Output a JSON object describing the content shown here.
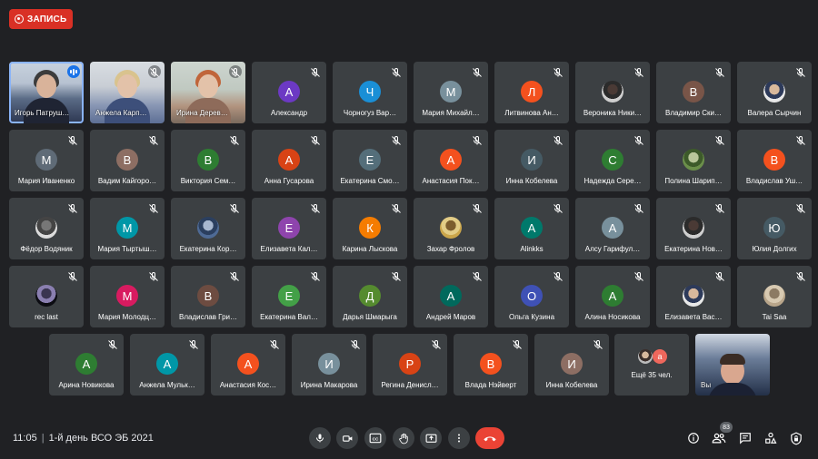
{
  "recording": {
    "label": "ЗАПИСЬ"
  },
  "meeting": {
    "time": "11:05",
    "title": "1-й день ВСО ЭБ 2021"
  },
  "participants_count": "83",
  "more_tile": {
    "label": "Ещё 35 чел.",
    "avatar_letter": "а",
    "avatar_color": "#ee675c"
  },
  "rows": [
    [
      {
        "name": "Игорь Патруш…",
        "video": "v1",
        "speaking": true
      },
      {
        "name": "Анжела Карп…",
        "video": "v2"
      },
      {
        "name": "Ирина Дерев…",
        "video": "v3"
      },
      {
        "name": "Александр",
        "letter": "А",
        "color": "#6c39c4"
      },
      {
        "name": "Чорногуз Вар…",
        "letter": "Ч",
        "color": "#1a8fd6"
      },
      {
        "name": "Мария Михайл…",
        "letter": "М",
        "color": "#78909c"
      },
      {
        "name": "Литвинова Ан…",
        "letter": "Л",
        "color": "#f4511e"
      },
      {
        "name": "Вероника Ники…",
        "photo": "p-dark"
      },
      {
        "name": "Владимир Ски…",
        "letter": "В",
        "color": "#795548"
      },
      {
        "name": "Валера Сырчин",
        "photo": "p-light"
      }
    ],
    [
      {
        "name": "Мария Иваненко",
        "letter": "М",
        "color": "#5f6b77"
      },
      {
        "name": "Вадим Кайгоро…",
        "letter": "В",
        "color": "#8d6e63"
      },
      {
        "name": "Виктория Сем…",
        "letter": "В",
        "color": "#2e7d32"
      },
      {
        "name": "Анна Гусарова",
        "letter": "А",
        "color": "#d84315"
      },
      {
        "name": "Екатерина Смо…",
        "letter": "Е",
        "color": "#546e7a"
      },
      {
        "name": "Анастасия Пок…",
        "letter": "А",
        "color": "#f4511e"
      },
      {
        "name": "Инна Кобелева",
        "letter": "И",
        "color": "#455a64"
      },
      {
        "name": "Надежда Сере…",
        "letter": "С",
        "color": "#2e7d32"
      },
      {
        "name": "Полина Шарип…",
        "photo": "p-green"
      },
      {
        "name": "Владислав Уш…",
        "letter": "В",
        "color": "#f4511e"
      }
    ],
    [
      {
        "name": "Фёдор Водяник",
        "photo": "p-grey"
      },
      {
        "name": "Мария Тыртыш…",
        "letter": "М",
        "color": "#0097a7"
      },
      {
        "name": "Екатерина Кор…",
        "photo": "p-blue"
      },
      {
        "name": "Елизавета Кал…",
        "letter": "Е",
        "color": "#8e44ad"
      },
      {
        "name": "Карина Лыскова",
        "letter": "К",
        "color": "#f57c00"
      },
      {
        "name": "Захар Фролов",
        "photo": "p-yellow"
      },
      {
        "name": "Alinkks",
        "letter": "A",
        "color": "#00796b"
      },
      {
        "name": "Алсу Гарифул…",
        "letter": "А",
        "color": "#78909c"
      },
      {
        "name": "Екатерина Нов…",
        "photo": "p-dark"
      },
      {
        "name": "Юлия Долгих",
        "letter": "Ю",
        "color": "#455a64"
      }
    ],
    [
      {
        "name": "rec last",
        "photo": "p-black"
      },
      {
        "name": "Мария Молодц…",
        "letter": "М",
        "color": "#d81b60"
      },
      {
        "name": "Владислав Гри…",
        "letter": "В",
        "color": "#6d4c41"
      },
      {
        "name": "Екатерина Вал…",
        "letter": "Е",
        "color": "#43a047"
      },
      {
        "name": "Дарья Шмарыга",
        "letter": "Д",
        "color": "#558b2f"
      },
      {
        "name": "Андрей Маров",
        "letter": "А",
        "color": "#00695c"
      },
      {
        "name": "Ольга Кузина",
        "letter": "О",
        "color": "#3f51b5"
      },
      {
        "name": "Алина Носикова",
        "letter": "А",
        "color": "#2e7d32"
      },
      {
        "name": "Елизавета Вас…",
        "photo": "p-light"
      },
      {
        "name": "Tai Saa",
        "photo": "p-tan"
      }
    ],
    [
      {
        "name": "Арина Новикова",
        "letter": "А",
        "color": "#2e7d32"
      },
      {
        "name": "Анжела Мульк…",
        "letter": "А",
        "color": "#0097a7"
      },
      {
        "name": "Анастасия Кос…",
        "letter": "А",
        "color": "#f4511e"
      },
      {
        "name": "Ирина Макарова",
        "letter": "И",
        "color": "#78909c"
      },
      {
        "name": "Регина Денисл…",
        "letter": "Р",
        "color": "#d84315"
      },
      {
        "name": "Влада Нэйверт",
        "letter": "В",
        "color": "#f4511e"
      },
      {
        "name": "Инна Кобелева",
        "letter": "И",
        "color": "#8d6e63"
      }
    ]
  ],
  "self_tile": {
    "name": "Вы"
  },
  "controls": {
    "mic": "mic-icon",
    "camera": "camera-icon",
    "captions": "CC",
    "raise_hand": "hand-icon",
    "present": "present-icon",
    "more": "more-vert-icon",
    "hangup": "hangup-icon"
  },
  "right_icons": [
    "info-icon",
    "people-icon",
    "chat-icon",
    "activities-icon",
    "lock-icon"
  ]
}
